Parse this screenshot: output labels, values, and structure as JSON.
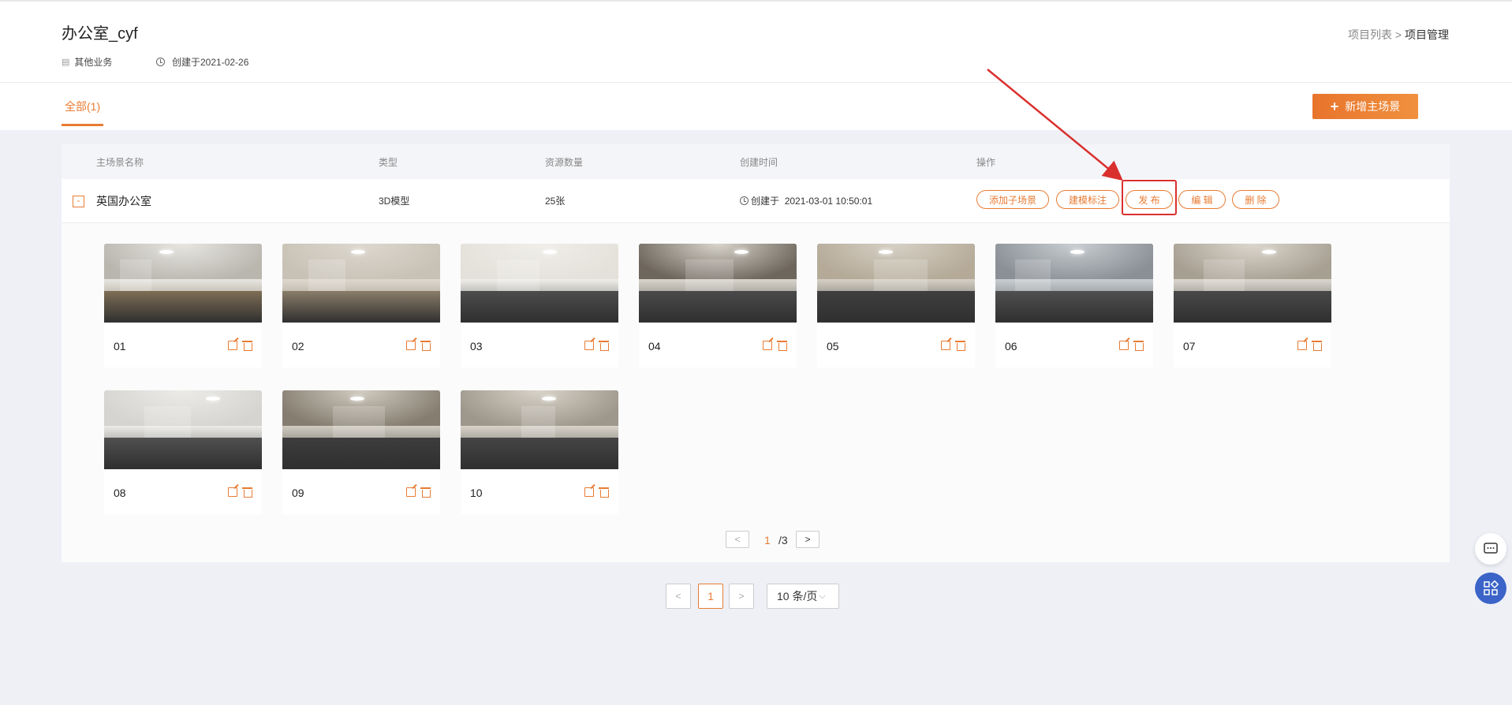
{
  "header": {
    "title": "办公室_cyf",
    "category": "其他业务",
    "created": "创建于2021-02-26",
    "breadcrumb": {
      "parent": "项目列表",
      "separator": ">",
      "current": "项目管理"
    }
  },
  "tabs": {
    "all_label": "全部(1)"
  },
  "add_button": {
    "label": "新增主场景",
    "icon": "plus-icon"
  },
  "table": {
    "columns": [
      "主场景名称",
      "类型",
      "资源数量",
      "创建时间",
      "操作"
    ],
    "row": {
      "collapse_symbol": "-",
      "name": "英国办公室",
      "type": "3D模型",
      "count": "25张",
      "created_prefix": "创建于",
      "created_time": "2021-03-01 10:50:01",
      "actions": [
        "添加子场景",
        "建模标注",
        "发 布",
        "编 辑",
        "删 除"
      ]
    },
    "scenes": [
      {
        "label": "01"
      },
      {
        "label": "02"
      },
      {
        "label": "03"
      },
      {
        "label": "04"
      },
      {
        "label": "05"
      },
      {
        "label": "06"
      },
      {
        "label": "07"
      },
      {
        "label": "08"
      },
      {
        "label": "09"
      },
      {
        "label": "10"
      }
    ],
    "inner_pager": {
      "prev": "<",
      "current": "1",
      "total": "/3",
      "next": ">"
    }
  },
  "pager": {
    "prev": "<",
    "current": "1",
    "next": ">",
    "page_size": "10 条/页"
  },
  "colors": {
    "accent": "#e87b32",
    "annotation": "#d9302e",
    "floating": "#3b63c8"
  }
}
